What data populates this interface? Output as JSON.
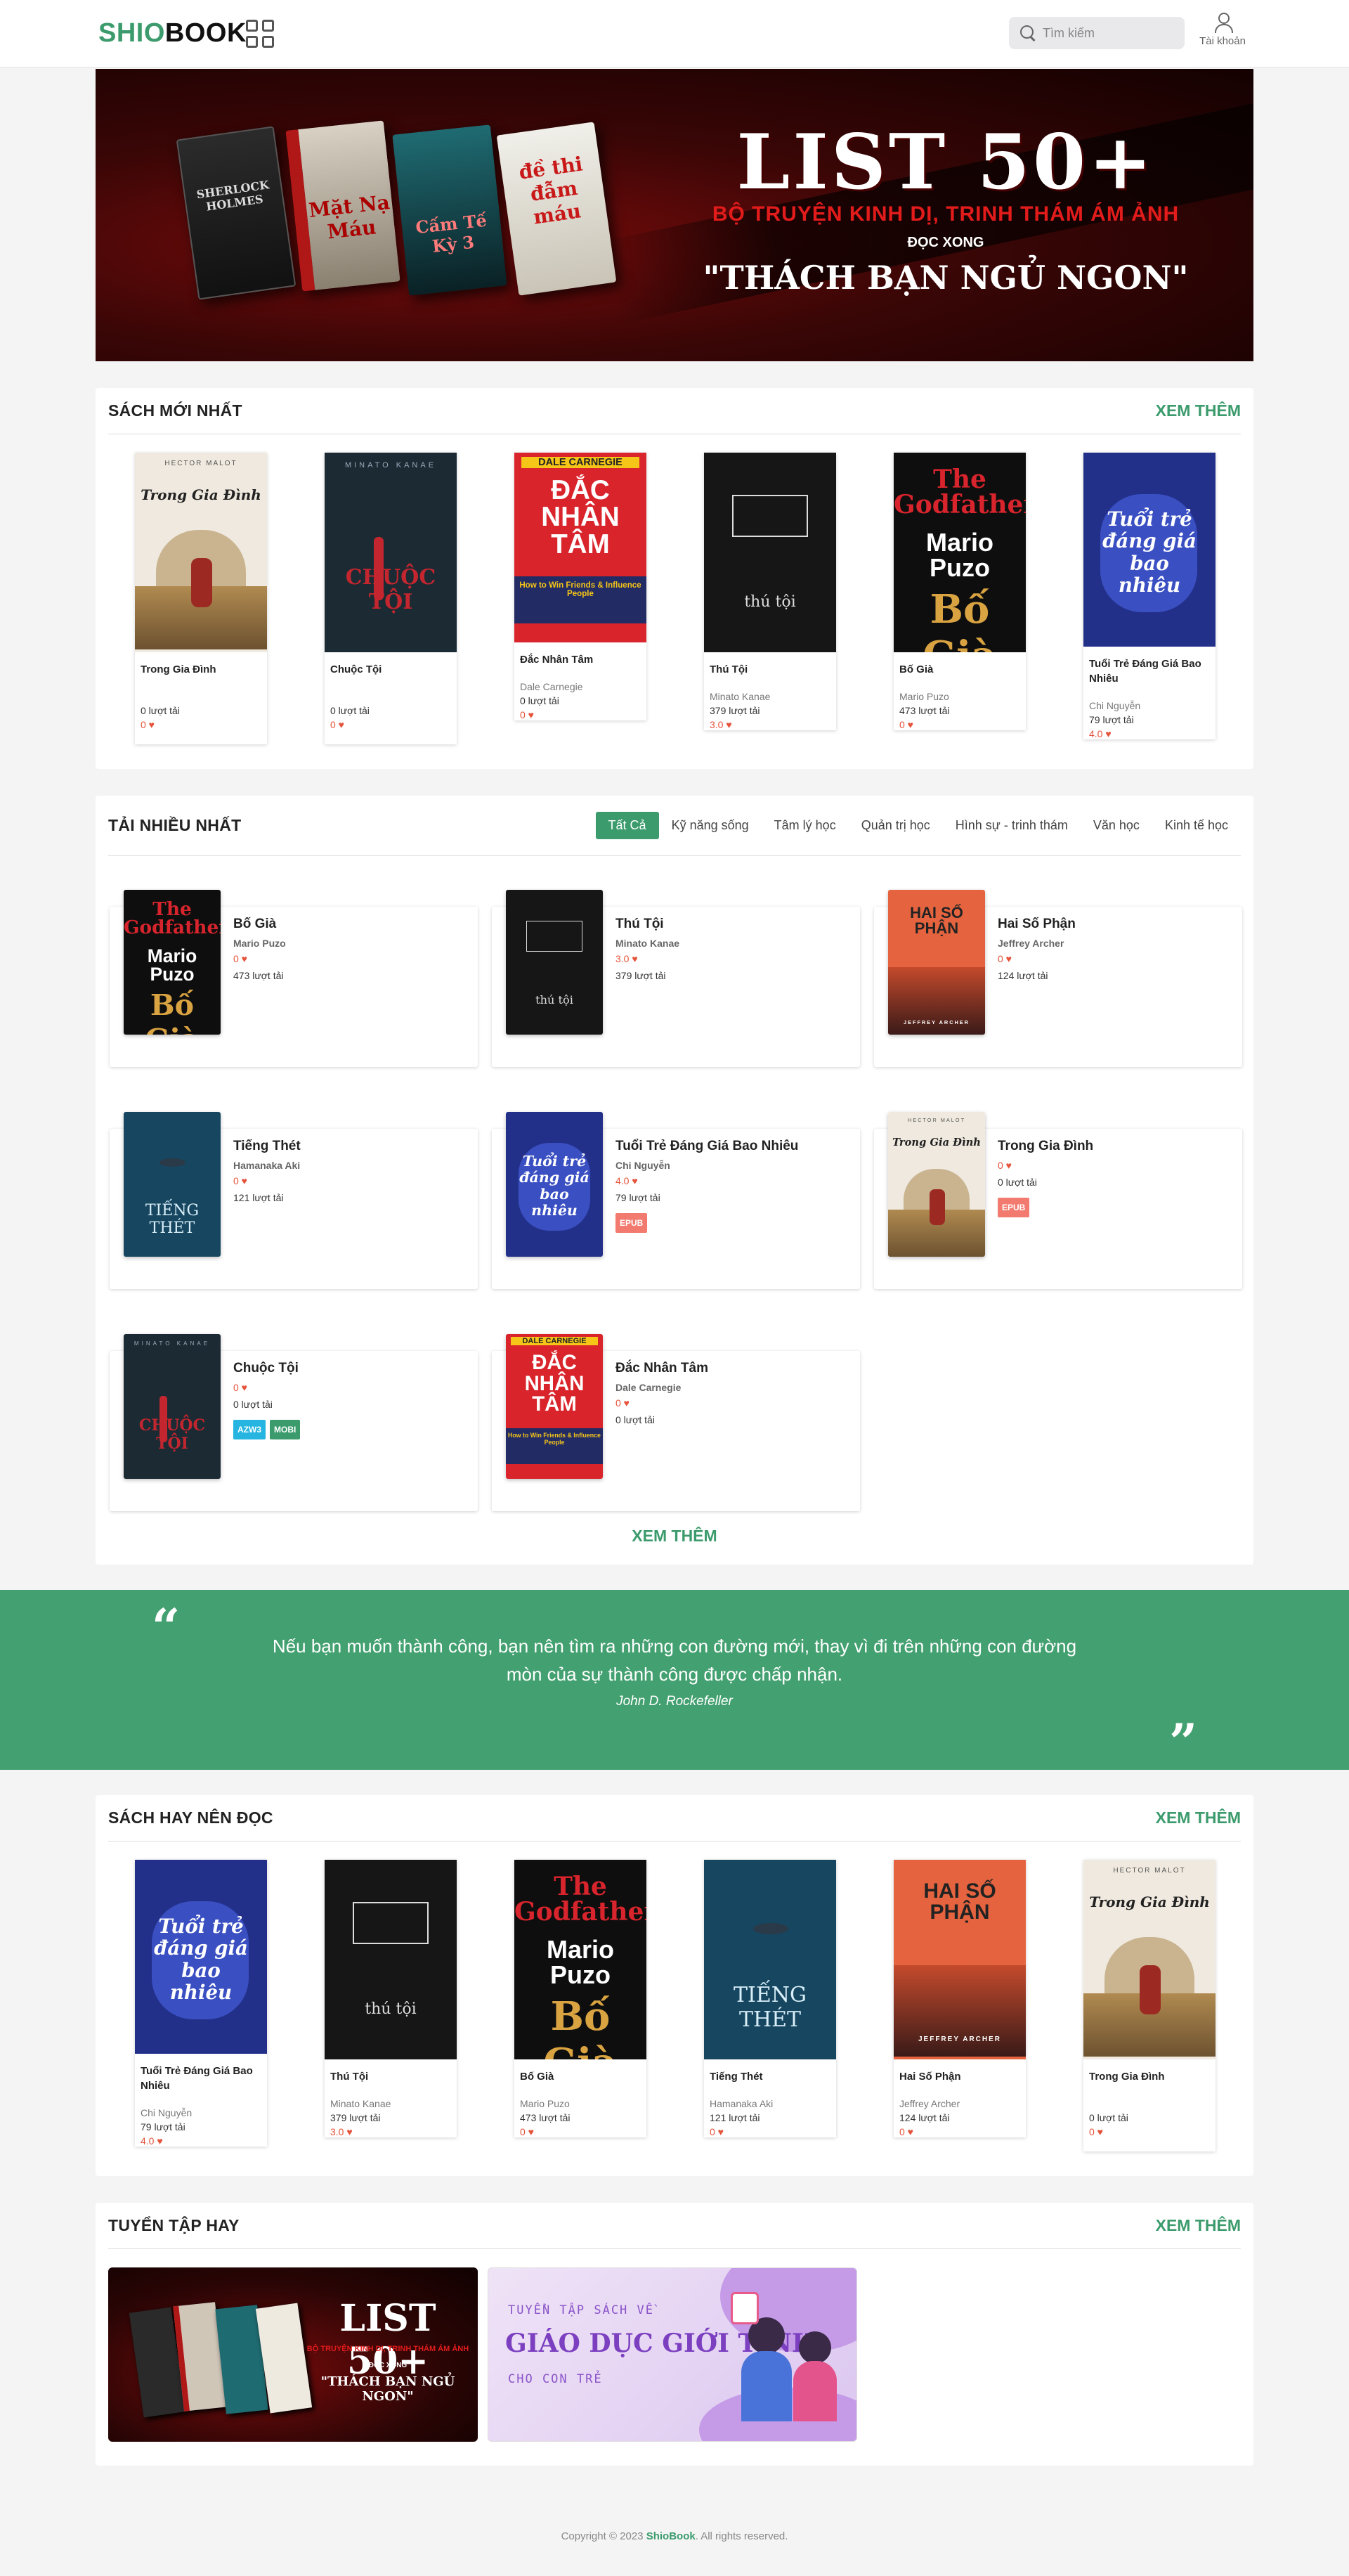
{
  "header": {
    "logo_part1": "SHIO",
    "logo_part2": "BOOK",
    "search_placeholder": "Tìm kiếm",
    "account_label": "Tài khoản"
  },
  "banner": {
    "title": "LIST 50+",
    "subtitle": "BỘ TRUYỆN KINH DỊ, TRINH THÁM ÁM ẢNH",
    "line2": "ĐỌC XONG",
    "quote": "\"THÁCH BẠN NGỦ NGON\"",
    "books": [
      "SHERLOCK HOLMES",
      "Mặt Nạ Máu",
      "Cấm Tế Kỳ 3",
      "đề thi đẫm máu"
    ]
  },
  "newest": {
    "title": "SÁCH MỚI NHẤT",
    "see_more": "XEM THÊM",
    "books": [
      {
        "title": "Trong Gia Đình",
        "author": "",
        "downloads": "0 lượt tải",
        "rating": "0"
      },
      {
        "title": "Chuộc Tội",
        "author": "",
        "downloads": "0 lượt tải",
        "rating": "0"
      },
      {
        "title": "Đắc Nhân Tâm",
        "author": "Dale Carnegie",
        "downloads": "0 lượt tải",
        "rating": "0"
      },
      {
        "title": "Thú Tội",
        "author": "Minato Kanae",
        "downloads": "379 lượt tải",
        "rating": "3.0"
      },
      {
        "title": "Bố Già",
        "author": "Mario Puzo",
        "downloads": "473 lượt tải",
        "rating": "0"
      },
      {
        "title": "Tuổi Trẻ Đáng Giá Bao Nhiêu",
        "author": "Chi Nguyễn",
        "downloads": "79 lượt tải",
        "rating": "4.0"
      }
    ]
  },
  "most_downloaded": {
    "title": "TẢI NHIỀU NHẤT",
    "see_more": "XEM THÊM",
    "tabs": [
      "Tất Cả",
      "Kỹ năng sống",
      "Tâm lý học",
      "Quản trị học",
      "Hình sự - trinh thám",
      "Văn học",
      "Kinh tế học"
    ],
    "books": [
      {
        "title": "Bố Già",
        "author": "Mario Puzo",
        "rating": "0",
        "downloads": "473 lượt tải",
        "badges": []
      },
      {
        "title": "Thú Tội",
        "author": "Minato Kanae",
        "rating": "3.0",
        "downloads": "379 lượt tải",
        "badges": []
      },
      {
        "title": "Hai Số Phận",
        "author": "Jeffrey Archer",
        "rating": "0",
        "downloads": "124 lượt tải",
        "badges": []
      },
      {
        "title": "Tiếng Thét",
        "author": "Hamanaka Aki",
        "rating": "0",
        "downloads": "121 lượt tải",
        "badges": []
      },
      {
        "title": "Tuổi Trẻ Đáng Giá Bao Nhiêu",
        "author": "Chi Nguyễn",
        "rating": "4.0",
        "downloads": "79 lượt tải",
        "badges": [
          "EPUB"
        ]
      },
      {
        "title": "Trong Gia Đình",
        "author": "",
        "rating": "0",
        "downloads": "0 lượt tải",
        "badges": [
          "EPUB"
        ]
      },
      {
        "title": "Chuộc Tội",
        "author": "",
        "rating": "0",
        "downloads": "0 lượt tải",
        "badges": [
          "AZW3",
          "MOBI"
        ]
      },
      {
        "title": "Đắc Nhân Tâm",
        "author": "Dale Carnegie",
        "rating": "0",
        "downloads": "0 lượt tải",
        "badges": []
      }
    ]
  },
  "quote": {
    "text": "Nếu bạn muốn thành công, bạn nên tìm ra những con đường mới, thay vì đi trên những con đường mòn của sự thành công được chấp nhận.",
    "author": "John D. Rockefeller"
  },
  "recommended": {
    "title": "SÁCH HAY NÊN ĐỌC",
    "see_more": "XEM THÊM",
    "books": [
      {
        "title": "Tuổi Trẻ Đáng Giá Bao Nhiêu",
        "author": "Chi Nguyễn",
        "downloads": "79 lượt tải",
        "rating": "4.0"
      },
      {
        "title": "Thú Tội",
        "author": "Minato Kanae",
        "downloads": "379 lượt tải",
        "rating": "3.0"
      },
      {
        "title": "Bố Già",
        "author": "Mario Puzo",
        "downloads": "473 lượt tải",
        "rating": "0"
      },
      {
        "title": "Tiếng Thét",
        "author": "Hamanaka Aki",
        "downloads": "121 lượt tải",
        "rating": "0"
      },
      {
        "title": "Hai Số Phận",
        "author": "Jeffrey Archer",
        "downloads": "124 lượt tải",
        "rating": "0"
      },
      {
        "title": "Trong Gia Đình",
        "author": "",
        "downloads": "0 lượt tải",
        "rating": "0"
      }
    ]
  },
  "collections": {
    "title": "TUYỂN TẬP HAY",
    "see_more": "XEM THÊM",
    "items": [
      {
        "title": "LIST 50+",
        "subtitle": "BỘ TRUYỆN KINH DỊ, TRINH THÁM ÁM ẢNH",
        "line2": "ĐỌC XONG",
        "quote": "\"THÁCH BẠN NGỦ NGON\""
      },
      {
        "kicker": "TUYỂN TẬP SÁCH VỀ",
        "title": "GIÁO DỤC GIỚI TÍNH",
        "subtitle": "CHO CON TRẺ"
      }
    ]
  },
  "footer": {
    "prefix": "Copyright © 2023 ",
    "brand": "ShioBook",
    "suffix": ". All rights reserved."
  },
  "covers": {
    "Trong Gia Đình": {
      "bg": "#efe9df",
      "author": "HECTOR MALOT",
      "script": "Trong Gia Đình",
      "style": "light"
    },
    "Chuộc Tội": {
      "bg": "#1b2a33",
      "author": "MINATO KANAE",
      "script": "CHUỘC TỘI",
      "style": "dark-red"
    },
    "Đắc Nhân Tâm": {
      "bg": "#d9242c",
      "author": "DALE CARNEGIE",
      "script": "ĐẮC NHÂN TÂM",
      "style": "red"
    },
    "Thú Tội": {
      "bg": "#161616",
      "author": "",
      "script": "thú tội",
      "style": "black"
    },
    "Bố Già": {
      "bg": "#0e0e0e",
      "author": "The Godfather",
      "script": "Mario Puzo Bố Già",
      "style": "godfather"
    },
    "Tuổi Trẻ Đáng Giá Bao Nhiêu": {
      "bg": "#23308a",
      "author": "",
      "script": "Tuổi trẻ đáng giá bao nhiêu",
      "style": "blue"
    },
    "Hai Số Phận": {
      "bg": "#e5643f",
      "author": "JEFFREY ARCHER",
      "script": "HAI SỐ PHẬN",
      "style": "orange"
    },
    "Tiếng Thét": {
      "bg": "#174660",
      "author": "",
      "script": "TIẾNG THÉT",
      "style": "ocean"
    }
  }
}
